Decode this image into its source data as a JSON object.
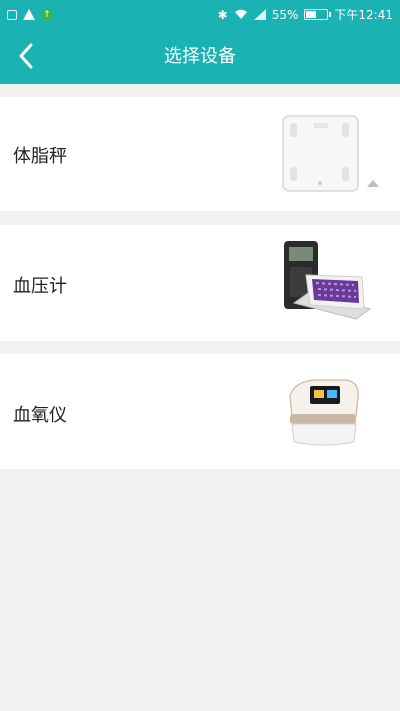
{
  "status_bar": {
    "battery_percent": "55%",
    "battery_level": 0.55,
    "time": "下午12:41",
    "left_icons": [
      "notification-icon",
      "warning-icon",
      "upload-icon"
    ],
    "right_icons": [
      "bluetooth-icon",
      "wifi-icon",
      "signal-icon",
      "battery-icon"
    ]
  },
  "header": {
    "title": "选择设备",
    "back_icon": "chevron-left-icon",
    "background": "#1bb2b4"
  },
  "devices": [
    {
      "label": "体脂秤",
      "image": "body-fat-scale-image"
    },
    {
      "label": "血压计",
      "image": "blood-pressure-monitor-image"
    },
    {
      "label": "血氧仪",
      "image": "pulse-oximeter-image"
    }
  ]
}
